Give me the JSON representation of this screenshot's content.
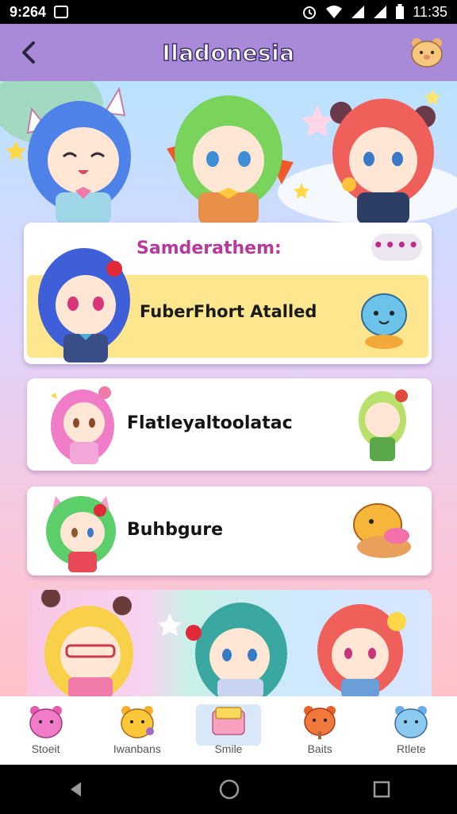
{
  "status_bar": {
    "time_left": "9:264",
    "time_right": "11:35"
  },
  "header": {
    "title": "Iladonesia",
    "back_icon": "chevron-left-icon",
    "profile_icon": "bear-avatar-icon"
  },
  "featured_card": {
    "header": "Samderathem:",
    "more_label": "••••",
    "item_label": "FuberFhort Atalled"
  },
  "list": [
    {
      "label": "Flatleyaltoolatac"
    },
    {
      "label": "Buhbgure"
    }
  ],
  "tabs": [
    {
      "label": "Stoeit",
      "icon": "pink-bear-icon"
    },
    {
      "label": "Iwanbans",
      "icon": "yellow-bear-icon"
    },
    {
      "label": "Smile",
      "icon": "folder-icon",
      "active": true
    },
    {
      "label": "Baits",
      "icon": "orange-bear-icon"
    },
    {
      "label": "Rtlete",
      "icon": "blue-bear-icon"
    }
  ],
  "colors": {
    "app_bar": "#a98ad8",
    "accent": "#b63a9b",
    "highlight": "#fde68e"
  }
}
